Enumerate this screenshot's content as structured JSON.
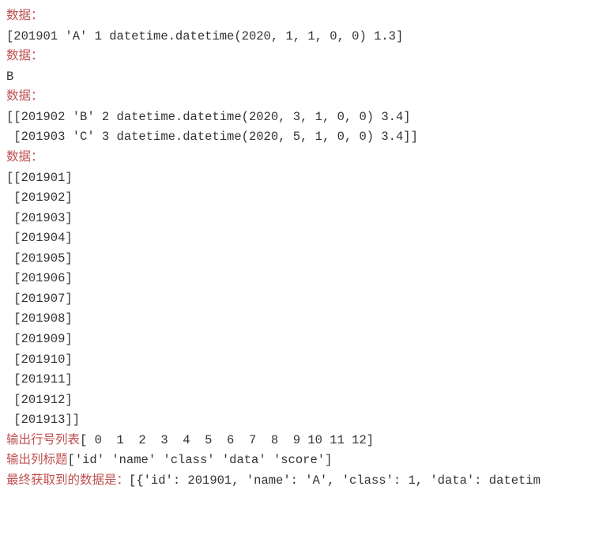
{
  "lines": {
    "0": "数据：",
    "1": "[201901 'A' 1 datetime.datetime(2020, 1, 1, 0, 0) 1.3]",
    "2": "数据：",
    "3": "B",
    "4": "数据：",
    "5": "[[201902 'B' 2 datetime.datetime(2020, 3, 1, 0, 0) 3.4]",
    "6": " [201903 'C' 3 datetime.datetime(2020, 5, 1, 0, 0) 3.4]]",
    "7": "数据：",
    "8": "[[201901]",
    "9": " [201902]",
    "10": " [201903]",
    "11": " [201904]",
    "12": " [201905]",
    "13": " [201906]",
    "14": " [201907]",
    "15": " [201908]",
    "16": " [201909]",
    "17": " [201910]",
    "18": " [201911]",
    "19": " [201912]",
    "20": " [201913]]",
    "21a": "输出行号列表",
    "21b": "[ 0  1  2  3  4  5  6  7  8  9 10 11 12]",
    "22a": "输出列标题",
    "22b": "['id' 'name' 'class' 'data' 'score']",
    "23a": "最终获取到的数据是：",
    "23b": "[{'id': 201901, 'name': 'A', 'class': 1, 'data': datetim"
  }
}
